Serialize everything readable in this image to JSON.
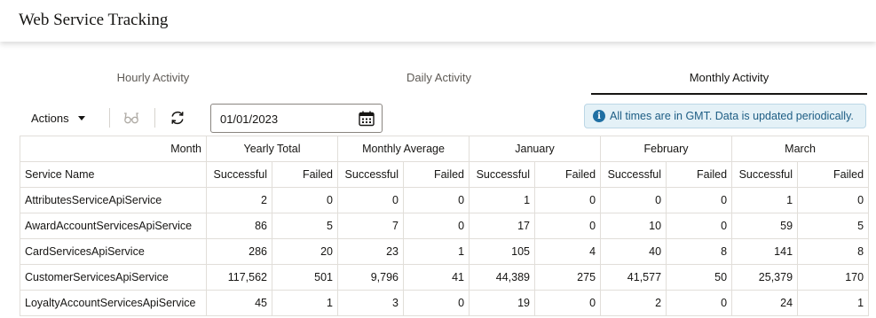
{
  "header": {
    "title": "Web Service Tracking"
  },
  "tabs": [
    {
      "label": "Hourly Activity",
      "active": false
    },
    {
      "label": "Daily Activity",
      "active": false
    },
    {
      "label": "Monthly Activity",
      "active": true
    }
  ],
  "toolbar": {
    "actions_label": "Actions",
    "date_value": "01/01/2023",
    "icons": [
      "caret-down-icon",
      "view-glasses-icon",
      "refresh-icon",
      "calendar-icon",
      "info-icon"
    ],
    "info_message": "All times are in GMT. Data is updated periodically."
  },
  "table": {
    "group_header_month_label": "Month",
    "groups": [
      "Yearly Total",
      "Monthly Average",
      "January",
      "February",
      "March"
    ],
    "service_name_header": "Service Name",
    "successful_label": "Successful",
    "failed_label": "Failed",
    "rows": [
      {
        "service": "AttributesServiceApiService",
        "values": [
          "2",
          "0",
          "0",
          "0",
          "1",
          "0",
          "0",
          "0",
          "1",
          "0"
        ]
      },
      {
        "service": "AwardAccountServicesApiService",
        "values": [
          "86",
          "5",
          "7",
          "0",
          "17",
          "0",
          "10",
          "0",
          "59",
          "5"
        ]
      },
      {
        "service": "CardServicesApiService",
        "values": [
          "286",
          "20",
          "23",
          "1",
          "105",
          "4",
          "40",
          "8",
          "141",
          "8"
        ]
      },
      {
        "service": "CustomerServicesApiService",
        "values": [
          "117,562",
          "501",
          "9,796",
          "41",
          "44,389",
          "275",
          "41,577",
          "50",
          "25,379",
          "170"
        ]
      },
      {
        "service": "LoyaltyAccountServicesApiService",
        "values": [
          "45",
          "1",
          "3",
          "0",
          "19",
          "0",
          "2",
          "0",
          "24",
          "1"
        ]
      }
    ]
  },
  "colors": {
    "accent": "#161513",
    "info_bg": "#e4f1f7",
    "info_text": "#1d5d84",
    "border": "#e1ded9"
  }
}
